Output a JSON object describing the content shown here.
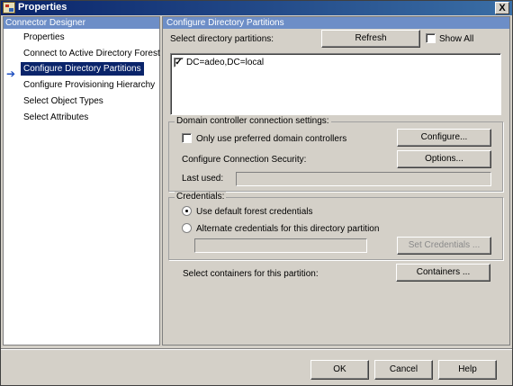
{
  "window": {
    "title": "Properties",
    "close_glyph": "X"
  },
  "sidebar": {
    "header": "Connector Designer",
    "items": [
      {
        "label": "Properties"
      },
      {
        "label": "Connect to Active Directory Forest"
      },
      {
        "label": "Configure Directory Partitions",
        "selected": true
      },
      {
        "label": "Configure Provisioning Hierarchy"
      },
      {
        "label": "Select Object Types"
      },
      {
        "label": "Select Attributes"
      }
    ],
    "current_indicator": "arrow-right-icon"
  },
  "main": {
    "header": "Configure Directory Partitions",
    "select_label": "Select directory partitions:",
    "refresh_label": "Refresh",
    "show_all_label": "Show All",
    "show_all_checked": false,
    "partitions": [
      {
        "label": "DC=adeo,DC=local",
        "checked": true
      }
    ],
    "dc_group": {
      "title": "Domain controller connection settings:",
      "preferred_label": "Only use preferred domain controllers",
      "preferred_checked": false,
      "configure_label": "Configure...",
      "security_label": "Configure Connection Security:",
      "options_label": "Options...",
      "last_used_label": "Last used:",
      "last_used_value": ""
    },
    "credentials_group": {
      "title": "Credentials:",
      "default_label": "Use default forest credentials",
      "alternate_label": "Alternate credentials for this directory partition",
      "selected": "default",
      "alternate_value": "",
      "set_credentials_label": "Set Credentials ..."
    },
    "containers_label": "Select containers for this partition:",
    "containers_button": "Containers ..."
  },
  "footer": {
    "ok_label": "OK",
    "cancel_label": "Cancel",
    "help_label": "Help"
  },
  "colors": {
    "title_bar": "#0a246a",
    "pane_header": "#6d8ec7",
    "selection": "#0a246a",
    "dialog_face": "#d4d0c8"
  }
}
